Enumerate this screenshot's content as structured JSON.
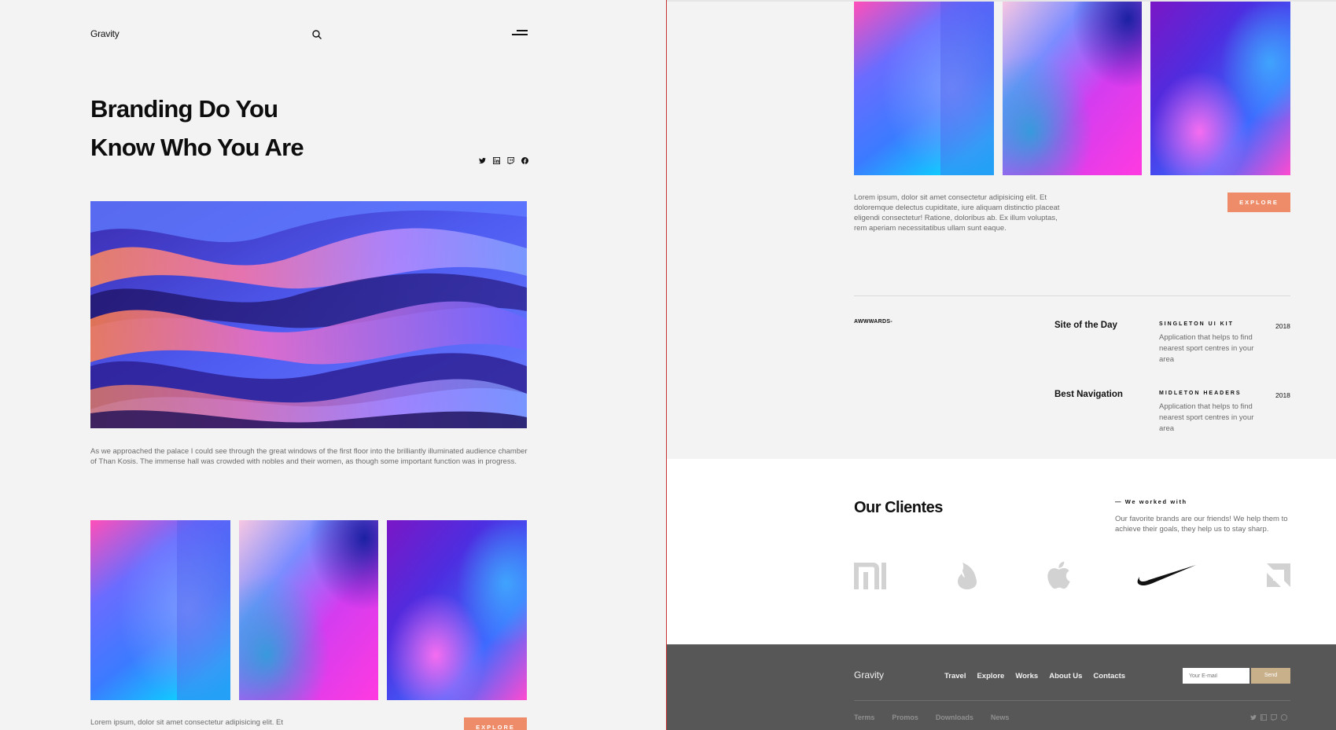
{
  "left": {
    "logo": "Gravity",
    "hero_title": [
      "Branding Do You",
      "Know Who You Are"
    ],
    "caption": "As we approached the palace I could see through the great windows of the first floor into the brilliantly illuminated audience chamber of Than Kosis. The immense hall was crowded with nobles and their women, as though some important function was in progress.",
    "lorem_partial": "Lorem ipsum, dolor sit amet consectetur adipisicing elit. Et",
    "explore_label": "EXPLORE",
    "social_icons": [
      "twitter-icon",
      "linkedin-icon",
      "twitch-icon",
      "facebook-icon"
    ]
  },
  "right": {
    "lorem": "Lorem ipsum, dolor sit amet consectetur adipisicing elit. Et doloremque delectus cupiditate, iure aliquam distinctio placeat eligendi consectetur! Ratione, doloribus ab. Ex illum voluptas, rem aperiam necessitatibus ullam sunt eaque.",
    "explore_label": "EXPLORE",
    "awwwards": "AWWWARDS-",
    "awards": [
      {
        "title": "Site of the Day",
        "kit": "SINGLETON UI KIT",
        "desc": "Application that helps to find nearest sport centres in your area",
        "year": "2018"
      },
      {
        "title": "Best Navigation",
        "kit": "MIDLETON HEADERS",
        "desc": "Application that helps to find nearest sport centres in your area",
        "year": "2018"
      }
    ],
    "clients": {
      "title": "Our Clientes",
      "worked_with": "— We worked with",
      "desc": "Our favorite brands are our friends! We help them to achieve their goals, they help us to stay sharp.",
      "brands": [
        "xiaomi-logo",
        "tinder-logo",
        "apple-logo",
        "nike-logo",
        "amd-logo"
      ]
    },
    "footer": {
      "logo": "Gravity",
      "nav": [
        "Travel",
        "Explore",
        "Works",
        "About Us",
        "Contacts"
      ],
      "email_placeholder": "Your E-mail",
      "send_label": "Send",
      "links": [
        "Terms",
        "Promos",
        "Downloads",
        "News"
      ],
      "social_icons": [
        "twitter-icon",
        "linkedin-icon",
        "twitch-icon",
        "facebook-icon"
      ]
    }
  },
  "colors": {
    "accent": "#ee8c6a",
    "send": "#c8b08a",
    "footer_bg": "#575757",
    "page_bg": "#f3f3f3"
  }
}
